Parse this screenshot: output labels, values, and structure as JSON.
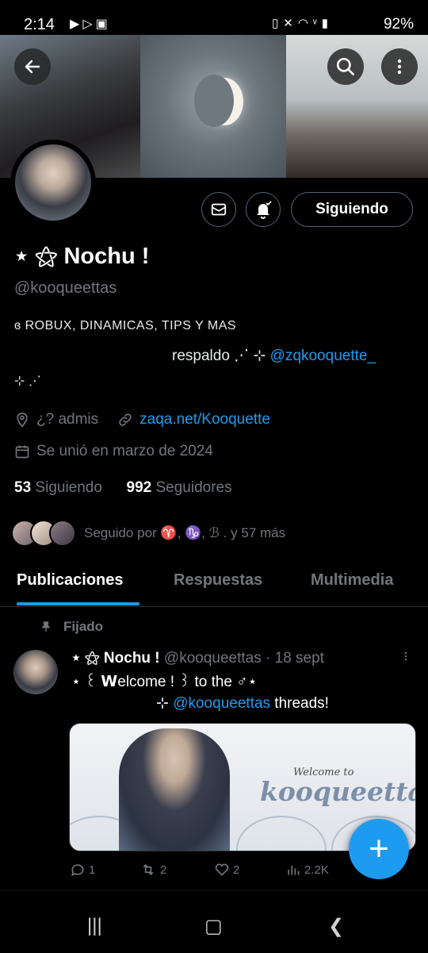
{
  "status_bar": {
    "time": "2:14",
    "battery": "92%",
    "left_icons": [
      "youtube-icon",
      "play-store-icon",
      "image-icon"
    ],
    "right_icons": [
      "battery-saver-icon",
      "mute-icon",
      "wifi-icon",
      "volte-icon",
      "signal-icon"
    ]
  },
  "header": {
    "back_icon": "back-arrow-icon",
    "search_icon": "search-icon",
    "more_icon": "more-vertical-icon"
  },
  "profile": {
    "display_name": "⋆ ⚝ Nochu !",
    "handle": "@kooqueettas",
    "bio_line1": "ɞ ROBUX, DINAMICAS, TIPS Y MAS",
    "bio_line2_text": "respaldo ⋰ ⊹ ",
    "bio_line2_link": "@zqkooquette_",
    "bio_line3": "⊹ ⋰",
    "location": "¿? admis",
    "website": "zaqa.net/Kooquette",
    "joined": "Se unió en marzo de 2024",
    "following_count": "53",
    "following_label": "Siguiendo",
    "followers_count": "992",
    "followers_label": "Seguidores",
    "followed_by": "Seguido por ♈, ♑, ℬ . y 57 más"
  },
  "actions": {
    "following_button": "Siguiendo"
  },
  "tabs": [
    {
      "label": "Publicaciones",
      "active": true
    },
    {
      "label": "Respuestas",
      "active": false
    },
    {
      "label": "Multimedia",
      "active": false
    }
  ],
  "post": {
    "pinned_label": "Fijado",
    "author_name": "⋆ ⚝ Nochu !",
    "author_handle": "@kooqueettas",
    "time": "18 sept",
    "line1": "⋆ ꒰ 𝗪elcome ! ꒱ to the ♂⋆",
    "line2_prefix": "⊹ ",
    "line2_link": "@kooqueettas",
    "line2_suffix": " threads!",
    "image_welcome": "Welcome to",
    "image_name": "kooqueettas",
    "replies": "1",
    "reposts": "2",
    "likes": "2",
    "views": "2.2K"
  },
  "colors": {
    "accent": "#1d9bf0",
    "background": "#000000",
    "secondary_text": "#71767b"
  }
}
